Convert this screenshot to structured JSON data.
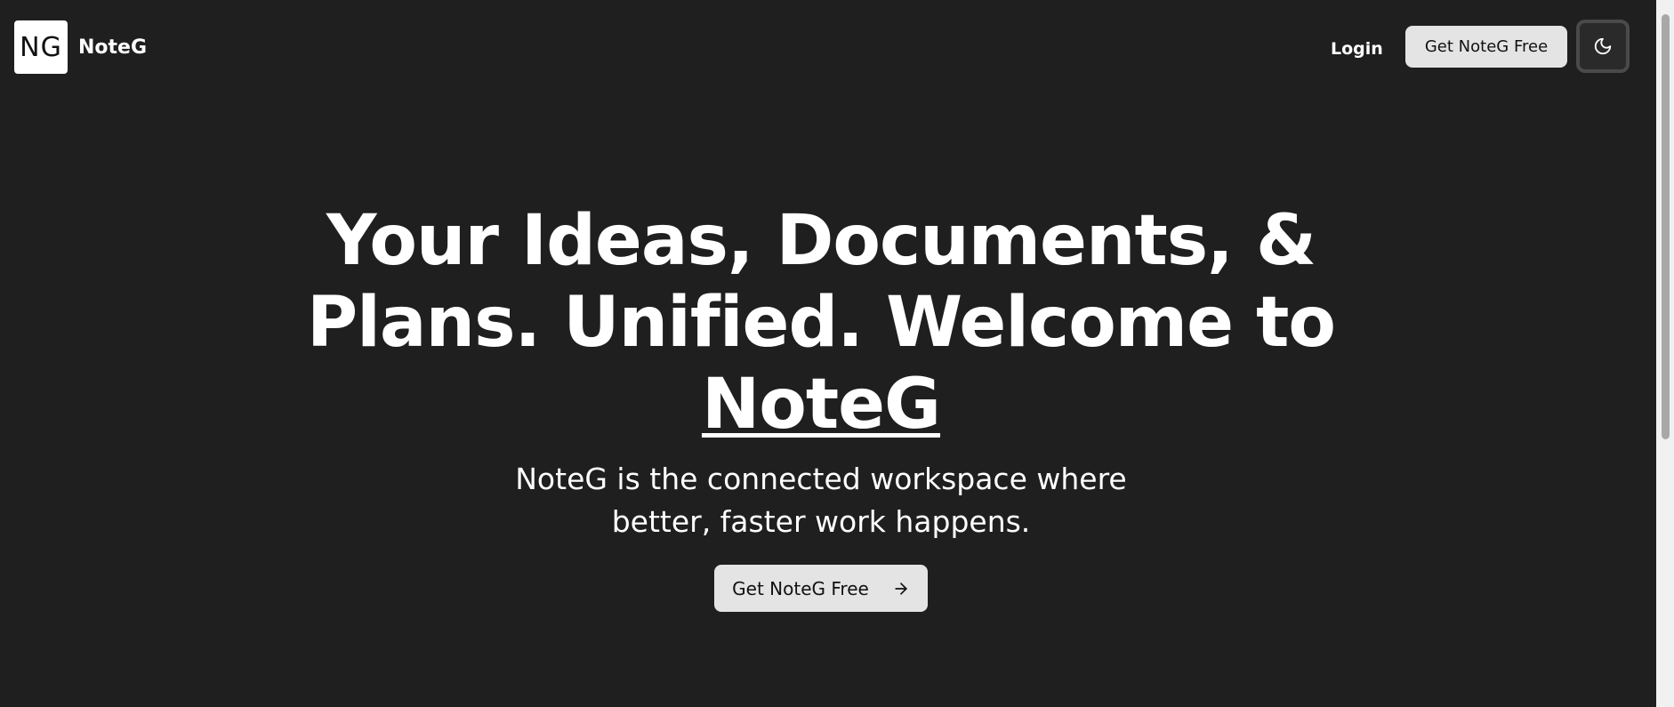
{
  "header": {
    "logo_mark": "NG",
    "brand": "NoteG",
    "login_label": "Login",
    "cta_label": "Get NoteG Free",
    "theme_toggle_icon": "moon-icon"
  },
  "hero": {
    "title_line1": "Your Ideas, Documents, &",
    "title_line2": "Plans. Unified. Welcome to",
    "title_brand": "NoteG",
    "subtitle_line1": "NoteG is the connected workspace where",
    "subtitle_line2": "better, faster work happens.",
    "cta_label": "Get NoteG Free",
    "cta_icon": "arrow-right-icon"
  },
  "colors": {
    "background": "#1f1f1f",
    "text": "#ffffff",
    "button_bg": "#e4e4e4",
    "button_text": "#111111"
  }
}
